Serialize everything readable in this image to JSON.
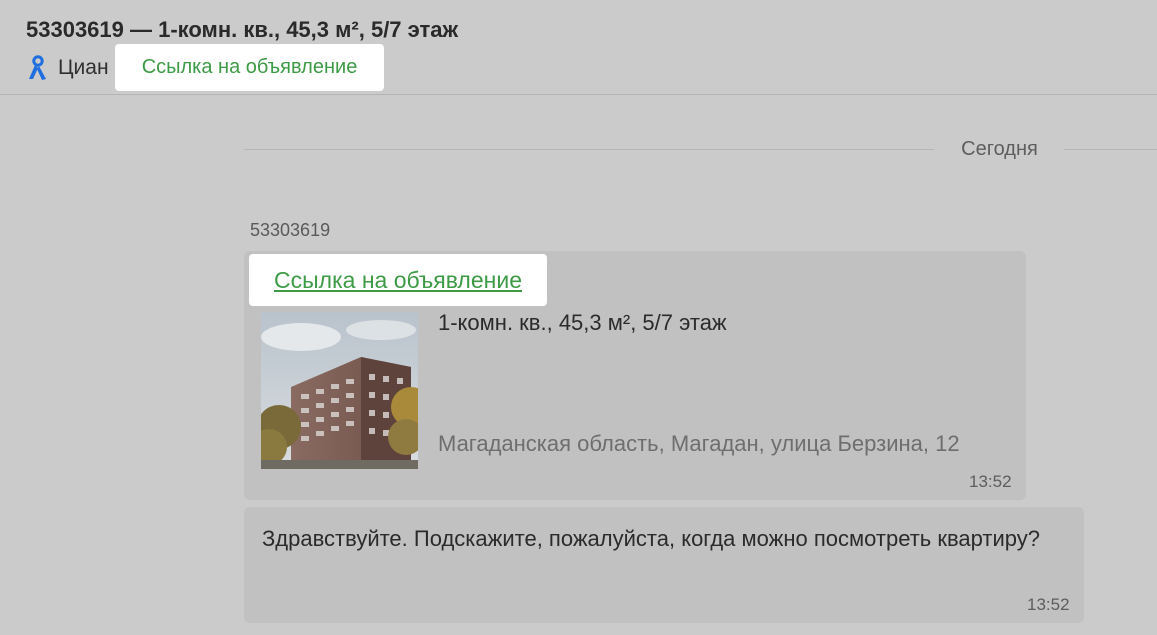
{
  "header": {
    "title": "53303619 — 1-комн. кв., 45,3 м², 5/7 этаж",
    "source_name": "Циан",
    "source_icon": "cian-logo-icon",
    "link_label": "Ссылка на объявление"
  },
  "chat": {
    "date_separator": "Сегодня",
    "sender_id": "53303619",
    "listing_card": {
      "link_label": "Ссылка на объявление",
      "title": "1-комн. кв., 45,3 м², 5/7 этаж",
      "address": "Магаданская область, Магадан, улица Берзина, 12",
      "time": "13:52"
    },
    "message": {
      "text": "Здравствуйте. Подскажите, пожалуйста, когда можно посмотреть квартиру?",
      "time": "13:52"
    }
  },
  "colors": {
    "background": "#cbcbcb",
    "bubble": "#c1c1c1",
    "link": "#3d9a45",
    "brand_icon": "#1f6fe0"
  }
}
